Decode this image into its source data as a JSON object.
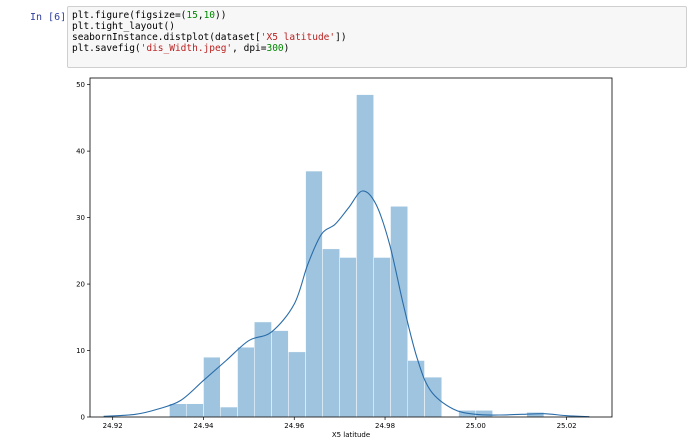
{
  "cell": {
    "prompt": "In [6]:",
    "code": {
      "l1_a": "plt.figure(figsize=(",
      "l1_n1": "15",
      "l1_b": ",",
      "l1_n2": "10",
      "l1_c": "))",
      "l2": "plt.tight_layout()",
      "l3_a": "seabornInstance.distplot(dataset[",
      "l3_s": "'X5 latitude'",
      "l3_b": "])",
      "l4_a": "plt.savefig(",
      "l4_s": "'dis_Width.jpeg'",
      "l4_b": ", dpi=",
      "l4_n": "300",
      "l4_c": ")"
    }
  },
  "chart_data": {
    "type": "bar",
    "xlabel": "X5 latitude",
    "ylabel": "",
    "xlim": [
      24.915,
      25.03
    ],
    "ylim": [
      0,
      51
    ],
    "xticks": [
      24.92,
      24.94,
      24.96,
      24.98,
      25.0,
      25.02
    ],
    "xtick_labels": [
      "24.92",
      "24.94",
      "24.96",
      "24.98",
      "25.00",
      "25.02"
    ],
    "yticks": [
      0,
      10,
      20,
      30,
      40,
      50
    ],
    "ytick_labels": [
      "0",
      "10",
      "20",
      "30",
      "40",
      "50"
    ],
    "histogram": {
      "bin_edges": [
        24.9325,
        24.9362,
        24.94,
        24.9437,
        24.9475,
        24.9512,
        24.955,
        24.9587,
        24.9625,
        24.9662,
        24.97,
        24.9737,
        24.9775,
        24.9812,
        24.985,
        24.9887,
        24.9925,
        24.9962,
        25.0,
        25.0037,
        25.0075,
        25.0112,
        25.015
      ],
      "values": [
        2,
        2,
        9,
        1.5,
        10.5,
        14.3,
        13,
        9.8,
        37,
        25.3,
        24,
        48.5,
        24,
        31.7,
        8.5,
        6,
        0,
        1,
        1,
        0,
        0,
        0.7
      ]
    },
    "kde": {
      "x": [
        24.918,
        24.925,
        24.93,
        24.935,
        24.94,
        24.945,
        24.95,
        24.955,
        24.96,
        24.963,
        24.966,
        24.969,
        24.972,
        24.975,
        24.978,
        24.981,
        24.984,
        24.987,
        24.99,
        24.995,
        25.0,
        25.005,
        25.01,
        25.015,
        25.02,
        25.025
      ],
      "y": [
        0.1,
        0.4,
        1.2,
        2.5,
        5.5,
        8.5,
        11.5,
        12.8,
        17.0,
        23.0,
        27.5,
        29.0,
        31.5,
        34.0,
        32.0,
        26.0,
        17.0,
        9.0,
        4.0,
        1.2,
        0.4,
        0.3,
        0.4,
        0.5,
        0.2,
        0.05
      ]
    },
    "bar_color": "#9ec4e0",
    "line_color": "#2a6ca8",
    "grid": false
  }
}
